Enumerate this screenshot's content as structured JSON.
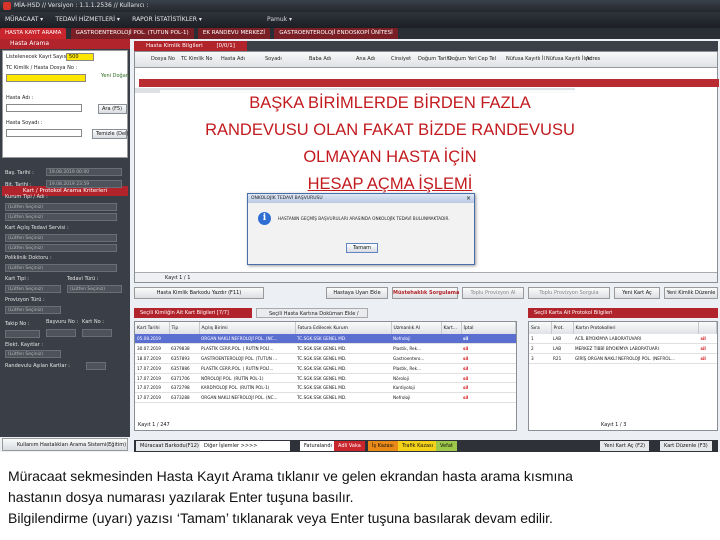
{
  "window": {
    "title": "MİA-HSD  //  Versiyon : 1.1.1.2536  //  Kullanıcı :"
  },
  "menu": {
    "items": [
      "MÜRACAAT ▾",
      "TEDAVİ HİZMETLERİ ▾",
      "RAPOR İSTATİSTİKLER ▾"
    ],
    "user": "Pamuk ▾"
  },
  "tabs": [
    "HASTA KAYIT ARAMA",
    "GASTROENTEROLOJİ POL. (TUTUN POL-1)",
    "EK RANDEVU MERKEZİ",
    "GASTROENTEROLOJİ ENDOSKOPİ ÜNİTESİ"
  ],
  "left": {
    "header": "Hasta Arama",
    "lbl_daily": "Listelenecek Kayıt Sayısı :",
    "daily_value": "500",
    "lbl_tc": "TC Kimlik / Hasta Dosya No :",
    "new_patient": "Yeni Doğan",
    "lbl_name": "Hasta Adı :",
    "search_btn": "Ara (F5)",
    "lbl_surname": "Hasta Soyadı :",
    "clear_btn": "Temizle (Del)",
    "section": "Kart / Protokol Arama Kriterleri",
    "lbl_start": "Baş. Tarihi :",
    "start_date": "19.08.2019 00:00",
    "lbl_end": "Bit. Tarihi :",
    "end_date": "19.08.2019 23:59",
    "lbl_kurum": "Kurum Tipi / Adı :",
    "lbl_kurum2": "Kart Açılış Tedavi Servisi :",
    "lbl_poli": "Poliklinik Doktoru :",
    "lbl_kart": "Kart Tipi :",
    "lbl_tedavi": "Tedavi Türü :",
    "lbl_provizyon": "Provizyon Türü :",
    "lbl_takip": "Takip No :",
    "lbl_basvuru": "Başvuru No :",
    "lbl_kart_no": "Kart No :",
    "lbl_elekt": "Elekt. Kayıtlar :",
    "lbl_randevu": "Randevulu Aşılan Kartlar :",
    "placeholder": "(Lütfen Seçiniz)",
    "bottom_btn": "Kullanım Hastalıkları Arama Sistemi(Eğitim)"
  },
  "main": {
    "header_tab": "Hasta Kimlik Bilgileri",
    "header_count": "[0/0/1]",
    "columns": [
      "Dosya No",
      "TC Kimlik No",
      "Hasta Adı",
      "Soyadı",
      "Baba Adı",
      "Ana Adı",
      "Cinsiyet",
      "Doğum Tarihi",
      "Doğum Yeri",
      "Cep Tel",
      "Nüfusa Kayıtlı İl",
      "Nüfusa Kayıtlı İlçe",
      "Adres"
    ],
    "footer": "Kayıt 1 / 1"
  },
  "overlay": {
    "line1": "BAŞKA BİRİMLERDE BİRDEN FAZLA",
    "line2": "RANDEVUSU OLAN FAKAT BİZDE RANDEVUSU",
    "line3": "OLMAYAN HASTA İÇİN",
    "line4": "HESAP AÇMA İŞLEMİ"
  },
  "dialog": {
    "title": "ONKOLOJİK TEDAVİ BAŞVURUSU",
    "message": "HASTANIN GEÇMİŞ BAŞVURULARI ARASINDA ONKOLOJİK TEDAVİ BULUNMAKTADIR.",
    "ok": "Tamam",
    "close": "×"
  },
  "actions": [
    "Hasta Kimlik Barkodu Yazdır (F11)",
    "Hastaya Uyarı Ekle",
    "Müstehaklık Sorgulama",
    "Toplu Provizyon Al",
    "Toplu Provizyon Sorgula",
    "Yeni Kart Aç",
    "Yeni Kimlik Düzenle"
  ],
  "lower": {
    "left_title": "Seçili Kimliğin Ait Kart Bilgileri",
    "left_count": "[7/7]",
    "mid_title": "Seçili Hasta Kartına Doküman Ekle / Görüntüle",
    "right_title": "Seçili Karta Ait Protokol Bilgileri",
    "columns": [
      "Kart Tarihi",
      "Tip",
      "Açılış Birimi",
      "Fatura Edilecek Kurum",
      "Uzmanlık Al",
      "Kart...",
      "İptal"
    ],
    "rows": [
      [
        "05.08.2019",
        "",
        "ORGAN NAKLİ NEFROLOJİ POL. (NC...",
        "TC.SGK.SSK GENEL MD.",
        "Nefroloji",
        "",
        "sil"
      ],
      [
        "30.07.2019",
        "6379838",
        "PLASTİK CERR.POL. ( RUTİN POLİ...",
        "TC.SGK.SSK GENEL MD.",
        "Plastik, Rek...",
        "",
        "sil"
      ],
      [
        "18.07.2019",
        "6357893",
        "GASTROENTEROLOJİ POL. (TUTUN ...",
        "TC.SGK.SSK GENEL MD.",
        "Gastroentero...",
        "",
        "sil"
      ],
      [
        "17.07.2019",
        "6357886",
        "PLASTİK CERR.POL. ( RUTİN POLİ...",
        "TC.SGK.SSK GENEL MD.",
        "Plastik, Rek...",
        "",
        "sil"
      ],
      [
        "17.07.2019",
        "6371706",
        "NÖROLOJİ POL. (RUTİN POL-1)",
        "TC.SGK.SSK GENEL MD.",
        "Nöroloji",
        "",
        "sil"
      ],
      [
        "17.07.2019",
        "6372798",
        "KARDİYOLOJİ POL. (RUTİN POL-1)",
        "TC.SGK.SSK GENEL MD.",
        "Kardiyoloji",
        "",
        "sil"
      ],
      [
        "17.07.2019",
        "6373288",
        "ORGAN NAKLİ NEFROLOJİ POL. (NC...",
        "TC.SGK.SSK GENEL MD.",
        "Nefroloji",
        "",
        "sil"
      ]
    ],
    "footer": "Kayıt 1 / 247",
    "right_columns": [
      "Sıra",
      "Prot.",
      "Kartın Protokolleri"
    ],
    "right_rows": [
      [
        "1",
        "LAB",
        "ACİL BİYOKİMYA LABORATUVARI",
        "sil"
      ],
      [
        "2",
        "LAB",
        "MERKEZ TIBBİ BİYOKİMYA LABORATUARI",
        "sil"
      ],
      [
        "3",
        "R21",
        "GİRİŞ ORGAN NAKLİ NEFROLOJİ POL. (NEFROL...",
        "sil"
      ]
    ],
    "right_footer": "Kayıt 1 / 3"
  },
  "status": {
    "barcode": "Müracaat Barkodu(F12)",
    "other": "Diğer İşlemler >>>>",
    "faturalandi": "Faturalandı",
    "adli": "Adli Vaka",
    "is": "İş Kazası",
    "trafik": "Trafik Kazası",
    "vefat": "Vefat",
    "new_card": "Yeni Kart Aç (F2)",
    "edit_card": "Kart Düzenle (F3)"
  },
  "caption": {
    "line1": "Müracaat sekmesinden Hasta Kayıt Arama tıklanır ve gelen ekrandan hasta arama kısmına",
    "line2": "hastanın dosya numarası yazılarak Enter tuşuna basılır.",
    "line3": "Bilgilendirme (uyarı) yazısı ‘Tamam’ tıklanarak veya Enter tuşuna basılarak devam edilir."
  }
}
